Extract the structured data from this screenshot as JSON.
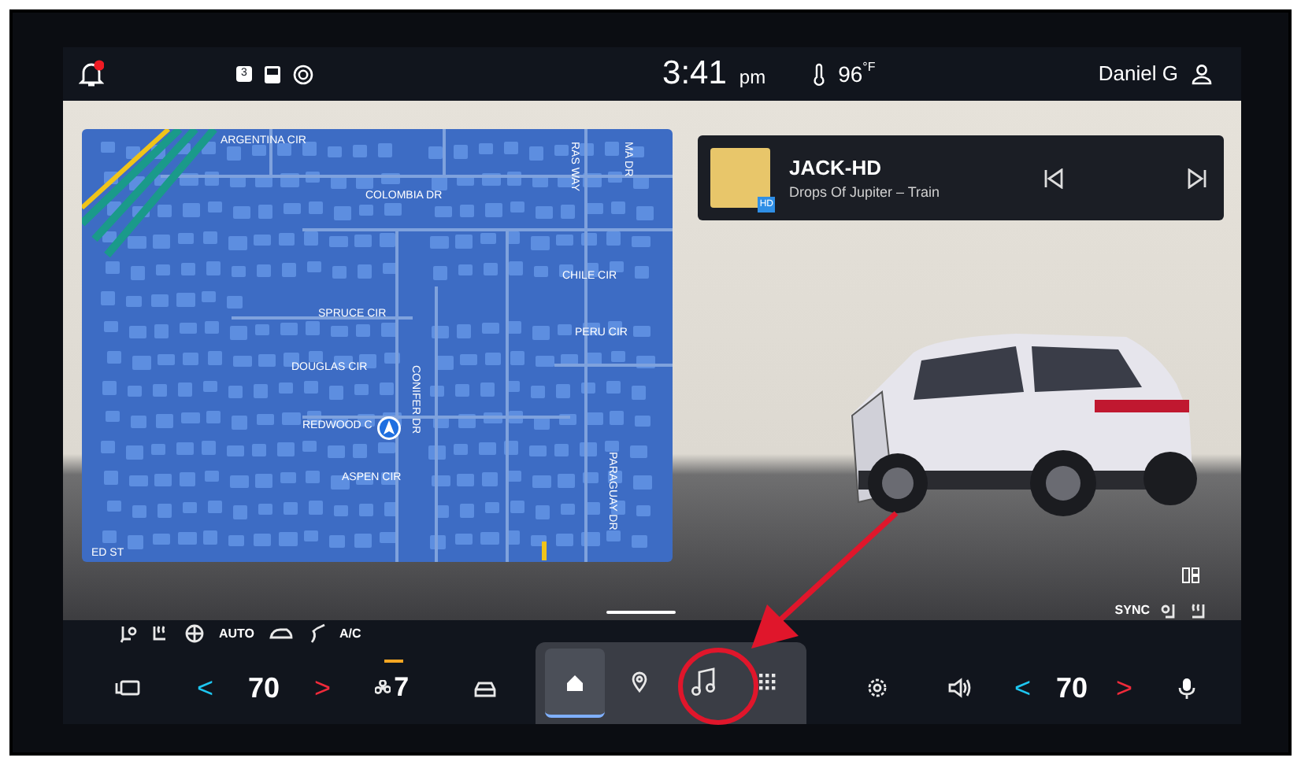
{
  "status_bar": {
    "notification_badge": true,
    "message_count": "3",
    "time": "3:41",
    "meridiem": "pm",
    "temperature": "96",
    "temperature_unit": "°F",
    "user": "Daniel G"
  },
  "map": {
    "streets": [
      {
        "name": "ARGENTINA CIR",
        "kind": "h"
      },
      {
        "name": "COLOMBIA DR",
        "kind": "h"
      },
      {
        "name": "RAS WAY",
        "kind": "v"
      },
      {
        "name": "MA DR",
        "kind": "v"
      },
      {
        "name": "CHILE CIR",
        "kind": "h"
      },
      {
        "name": "SPRUCE CIR",
        "kind": "h"
      },
      {
        "name": "PERU CIR",
        "kind": "h"
      },
      {
        "name": "DOUGLAS CIR",
        "kind": "h"
      },
      {
        "name": "CONIFER DR",
        "kind": "v"
      },
      {
        "name": "REDWOOD C",
        "kind": "h"
      },
      {
        "name": "PARAGUAY DR",
        "kind": "v"
      },
      {
        "name": "ASPEN CIR",
        "kind": "h"
      },
      {
        "name": "ED ST",
        "kind": "h"
      }
    ]
  },
  "now_playing": {
    "station": "JACK-HD",
    "track": "Drops Of Jupiter – Train",
    "hd_badge": "HD"
  },
  "climate": {
    "auto_label": "AUTO",
    "ac_label": "A/C",
    "sync_label": "SYNC",
    "temp_down_symbol": "<",
    "temp_up_symbol": ">",
    "passenger_temp_down_symbol": "<",
    "passenger_temp_up_symbol": ">",
    "driver_temp": "70",
    "passenger_temp": "70",
    "fan_speed": "7"
  },
  "dock": [
    {
      "kind": "home",
      "selected": true
    },
    {
      "kind": "location",
      "selected": false
    },
    {
      "kind": "music",
      "selected": false
    },
    {
      "kind": "apps",
      "selected": false
    }
  ]
}
